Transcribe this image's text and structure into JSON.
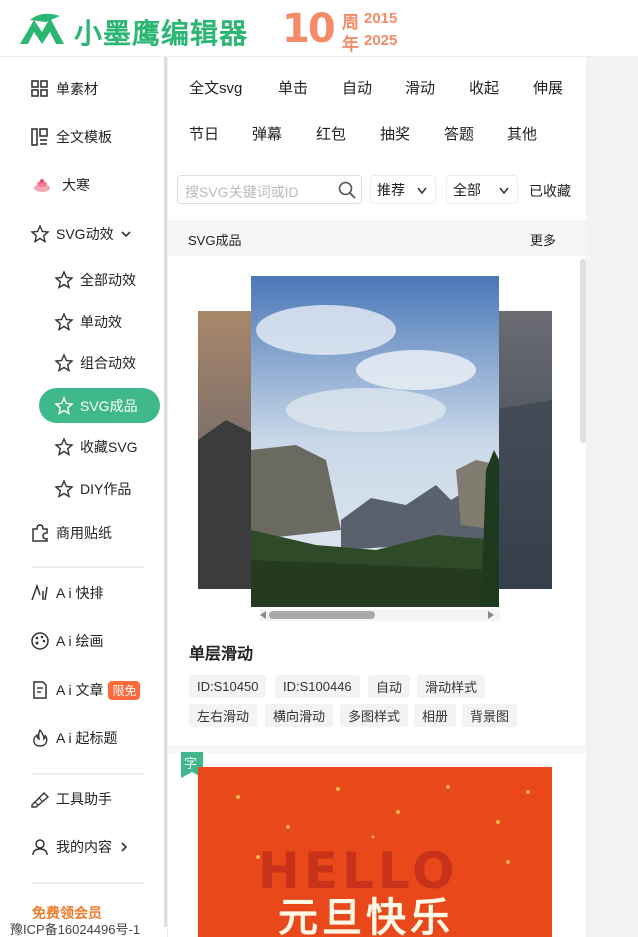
{
  "header": {
    "logo_text": "小墨鹰编辑器",
    "anniversary_number": "10",
    "anniversary_zhou": "周",
    "anniversary_nian": "年",
    "year_start": "2015",
    "year_end": "2025"
  },
  "sidebar": {
    "items": [
      {
        "label": "单素材",
        "icon": "grid-icon"
      },
      {
        "label": "全文模板",
        "icon": "template-icon"
      },
      {
        "label": "大寒",
        "icon": "festival-icon"
      },
      {
        "label": "SVG动效",
        "icon": "star-icon"
      },
      {
        "label": "全部动效",
        "icon": "star-icon"
      },
      {
        "label": "单动效",
        "icon": "star-icon"
      },
      {
        "label": "组合动效",
        "icon": "star-icon"
      },
      {
        "label": "SVG成品",
        "icon": "star-icon",
        "active": true
      },
      {
        "label": "收藏SVG",
        "icon": "star-icon"
      },
      {
        "label": "DIY作品",
        "icon": "star-icon"
      },
      {
        "label": "商用贴纸",
        "icon": "puzzle-icon"
      },
      {
        "label": "A i 快排",
        "icon": "ai-icon"
      },
      {
        "label": "A i 绘画",
        "icon": "palette-icon"
      },
      {
        "label": "A i 文章",
        "icon": "doc-icon",
        "badge": "限免"
      },
      {
        "label": "A i 起标题",
        "icon": "fire-icon"
      },
      {
        "label": "工具助手",
        "icon": "tool-icon"
      },
      {
        "label": "我的内容",
        "icon": "user-icon"
      }
    ],
    "vip_label": "免费领会员",
    "icp": "豫ICP备16024496号-1"
  },
  "main": {
    "categories_row1": [
      "全文svg",
      "单击",
      "自动",
      "滑动",
      "收起",
      "伸展"
    ],
    "categories_row2": [
      "节日",
      "弹幕",
      "红包",
      "抽奖",
      "答题",
      "其他"
    ],
    "search_placeholder": "搜SVG关键词或ID",
    "sort_dropdown": "推荐",
    "scope_dropdown": "全部",
    "collected_label": "已收藏",
    "section_title": "SVG成品",
    "more_label": "更多",
    "card": {
      "title": "单层滑动",
      "tags_row1": [
        "ID:S10450",
        "ID:S100446",
        "自动",
        "滑动样式"
      ],
      "tags_row2": [
        "左右滑动",
        "横向滑动",
        "多图样式",
        "相册",
        "背景图"
      ]
    },
    "card2": {
      "badge": "字",
      "hello": "HELLO",
      "title": "元旦快乐"
    }
  },
  "colors": {
    "brand_green": "#2bb673",
    "active_pill": "#3fb98b",
    "anniversary_orange": "#f58a66",
    "limit_badge": "#ff6a3d"
  }
}
